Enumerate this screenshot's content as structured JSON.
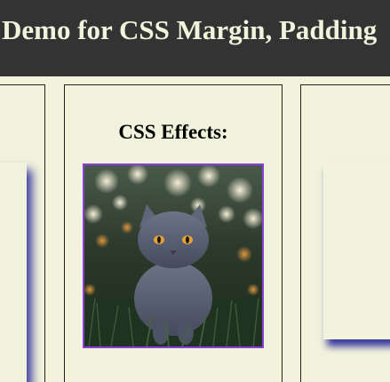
{
  "header": {
    "title": "Demo for CSS Margin, Padding"
  },
  "cards": {
    "middle": {
      "heading": "CSS Effects:",
      "image_subject": "cat-photo"
    }
  },
  "colors": {
    "header_bg": "#333333",
    "header_text": "#f2f3dc",
    "page_bg": "#f2f3dc",
    "image_border": "#8a3fd6",
    "shadow": "#3a3aa0"
  }
}
